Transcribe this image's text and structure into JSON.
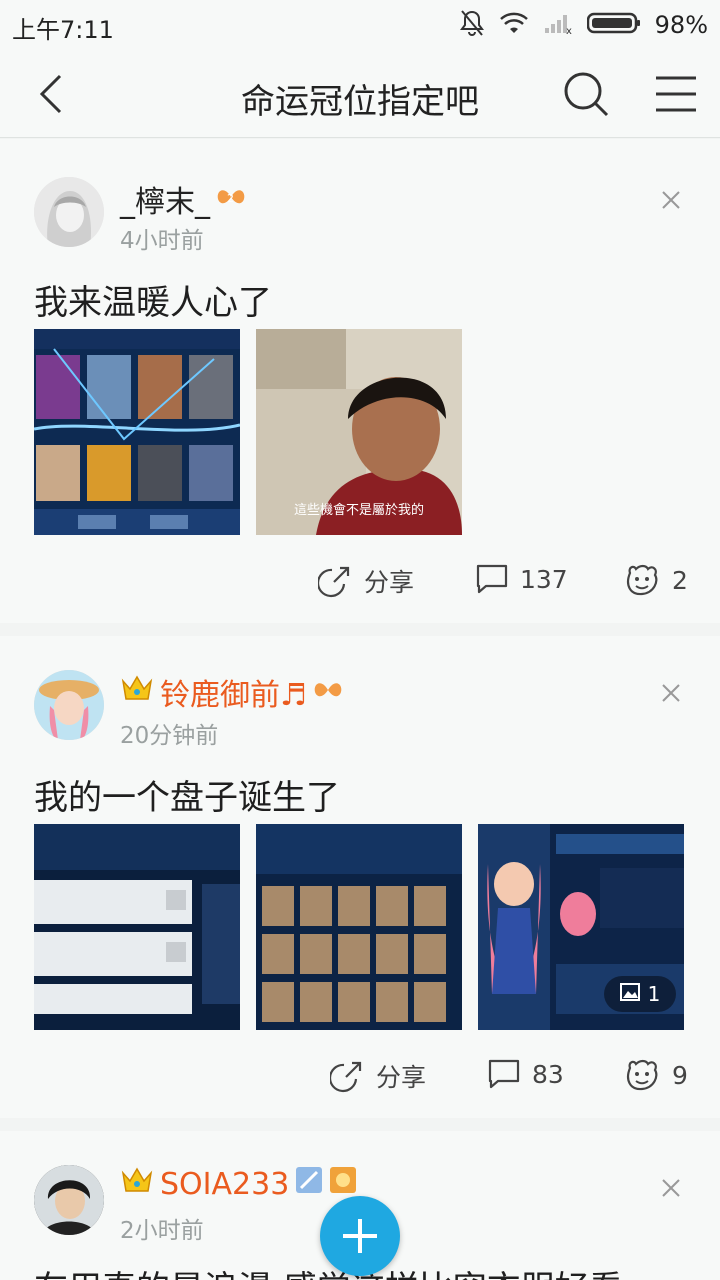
{
  "status_bar": {
    "time": "上午7:11",
    "battery": "98%"
  },
  "nav": {
    "title": "命运冠位指定吧"
  },
  "posts": [
    {
      "username": "_檸末_",
      "time": "4小时前",
      "text": "我来温暖人心了",
      "image_caption": "這些機會不是屬於我的",
      "share_label": "分享",
      "comments": "137",
      "likes": "2"
    },
    {
      "username": "铃鹿御前♬",
      "time": "20分钟前",
      "text": "我的一个盘子诞生了",
      "image_count": "1",
      "share_label": "分享",
      "comments": "83",
      "likes": "9"
    },
    {
      "username": "SOIA233",
      "time": "2小时前",
      "text": "在用真的是浪漫 感觉这样比穿衣服好看"
    }
  ],
  "colors": {
    "accent_orange": "#ea5b1f",
    "fab_blue": "#1fa8e1",
    "background": "#f2f4f3"
  }
}
